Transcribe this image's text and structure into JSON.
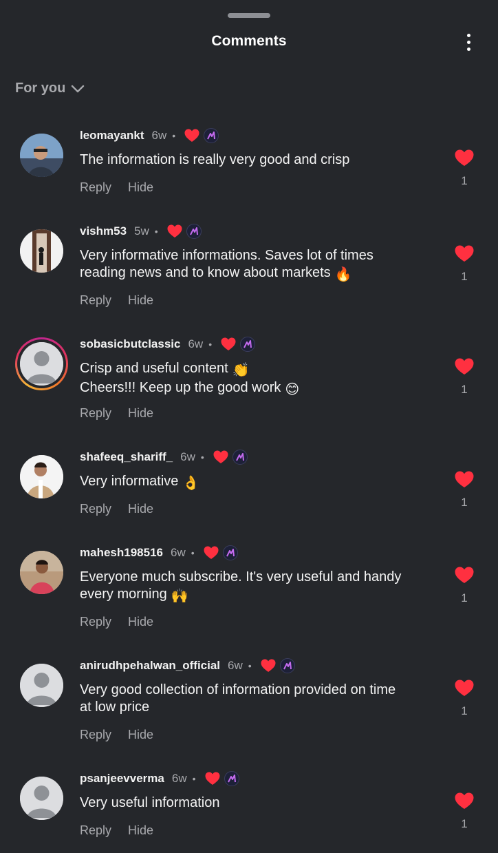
{
  "header": {
    "title": "Comments",
    "more_icon": "more-vertical-icon"
  },
  "filter": {
    "label": "For you",
    "icon": "chevron-down-icon"
  },
  "colors": {
    "background": "#25272b",
    "heart": "#ff3040",
    "muted_text": "#a8a9ad",
    "primary_text": "#f3f3f3"
  },
  "comments": [
    {
      "username": "leomayankt",
      "time": "6w",
      "bullet": "•",
      "lines": [
        "The information is really very good and crisp"
      ],
      "emoji": "",
      "reply_label": "Reply",
      "hide_label": "Hide",
      "likes": "1",
      "liked_by_creator": true
    },
    {
      "username": "vishm53",
      "time": "5w",
      "bullet": "•",
      "lines": [
        "Very informative informations. Saves lot of times",
        "reading news and to know about markets"
      ],
      "emoji": "🔥",
      "reply_label": "Reply",
      "hide_label": "Hide",
      "likes": "1",
      "liked_by_creator": true
    },
    {
      "username": "sobasicbutclassic",
      "time": "6w",
      "bullet": "•",
      "lines": [
        "Crisp and useful content",
        "Cheers!!! Keep up the good work"
      ],
      "emoji": "👏 😊",
      "reply_label": "Reply",
      "hide_label": "Hide",
      "likes": "1",
      "liked_by_creator": true
    },
    {
      "username": "shafeeq_shariff_",
      "time": "6w",
      "bullet": "•",
      "lines": [
        "Very informative"
      ],
      "emoji": "👌",
      "reply_label": "Reply",
      "hide_label": "Hide",
      "likes": "1",
      "liked_by_creator": true
    },
    {
      "username": "mahesh198516",
      "time": "6w",
      "bullet": "•",
      "lines": [
        "Everyone much subscribe. It's very useful and handy",
        "every morning"
      ],
      "emoji": "🙌",
      "reply_label": "Reply",
      "hide_label": "Hide",
      "likes": "1",
      "liked_by_creator": true
    },
    {
      "username": "anirudhpehalwan_official",
      "time": "6w",
      "bullet": "•",
      "lines": [
        "Very good collection of information provided on time",
        "at low price"
      ],
      "emoji": "",
      "reply_label": "Reply",
      "hide_label": "Hide",
      "likes": "1",
      "liked_by_creator": true
    },
    {
      "username": "psanjeevverma",
      "time": "6w",
      "bullet": "•",
      "lines": [
        "Very useful information"
      ],
      "emoji": "",
      "reply_label": "Reply",
      "hide_label": "Hide",
      "likes": "1",
      "liked_by_creator": true
    }
  ]
}
